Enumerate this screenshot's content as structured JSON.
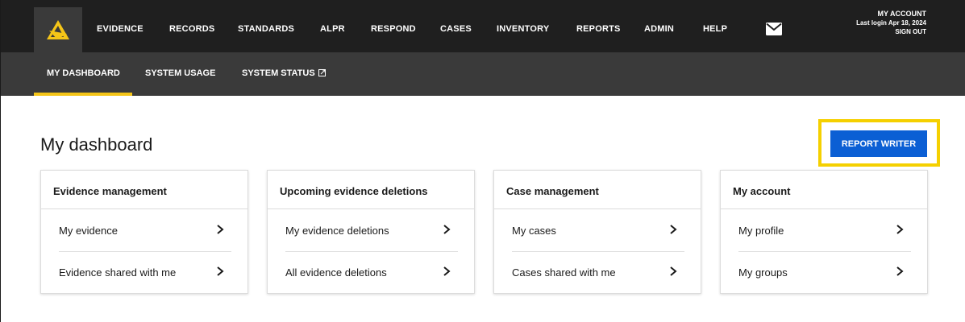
{
  "topnav": {
    "items": [
      "EVIDENCE",
      "RECORDS",
      "STANDARDS",
      "ALPR",
      "RESPOND",
      "CASES",
      "INVENTORY",
      "REPORTS",
      "ADMIN",
      "HELP"
    ],
    "account_title": "MY ACCOUNT",
    "last_login": "Last login Apr 18, 2024",
    "sign_out": "SIGN OUT",
    "mail_icon": "mail-icon",
    "logo_icon": "logo-icon"
  },
  "subnav": {
    "tabs": [
      "MY DASHBOARD",
      "SYSTEM USAGE",
      "SYSTEM STATUS"
    ],
    "active_tab": "MY DASHBOARD",
    "external_icon": "external-link-icon"
  },
  "page": {
    "title": "My dashboard",
    "report_writer_label": "REPORT WRITER"
  },
  "cards": [
    {
      "title": "Evidence management",
      "links": [
        "My evidence",
        "Evidence shared with me"
      ]
    },
    {
      "title": "Upcoming evidence deletions",
      "links": [
        "My evidence deletions",
        "All evidence deletions"
      ]
    },
    {
      "title": "Case management",
      "links": [
        "My cases",
        "Cases shared with me"
      ]
    },
    {
      "title": "My account",
      "links": [
        "My profile",
        "My groups"
      ]
    }
  ],
  "colors": {
    "topbar": "#1f1f1f",
    "subbar": "#3a3a3a",
    "accent_yellow": "#f5c518",
    "highlight_yellow": "#f5d000",
    "button_blue": "#0b5fd4"
  }
}
